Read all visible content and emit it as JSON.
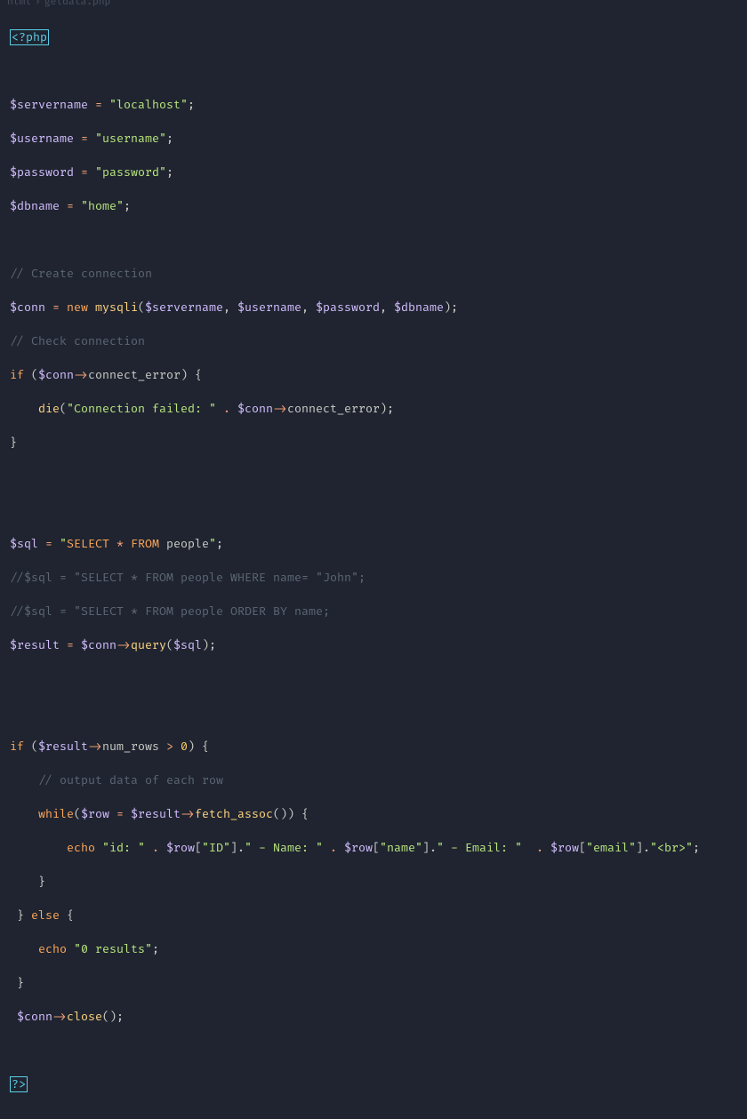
{
  "breadcrumb": {
    "seg1": "html",
    "seg2": "getdata.php"
  },
  "code": {
    "l1_open": "<?php",
    "l2_var": "$servername",
    "l2_eq": " = ",
    "l2_str": "\"localhost\"",
    "l2_sc": ";",
    "l3_var": "$username",
    "l3_eq": " = ",
    "l3_str": "\"username\"",
    "l3_sc": ";",
    "l4_var": "$password",
    "l4_eq": " = ",
    "l4_str": "\"password\"",
    "l4_sc": ";",
    "l5_var": "$dbname",
    "l5_eq": " = ",
    "l5_str": "\"home\"",
    "l5_sc": ";",
    "l6_comm": "// Create connection",
    "l7_var": "$conn",
    "l7_eq": " = ",
    "l7_new": "new",
    "l7_sp": " ",
    "l7_fn": "mysqli",
    "l7_op": "(",
    "l7_a1": "$servername",
    "l7_c1": ", ",
    "l7_a2": "$username",
    "l7_c2": ", ",
    "l7_a3": "$password",
    "l7_c3": ", ",
    "l7_a4": "$dbname",
    "l7_cp": ");",
    "l8_comm": "// Check connection",
    "l9_if": "if",
    "l9_sp": " (",
    "l9_var": "$conn",
    "l9_arr": "->",
    "l9_prop": "connect_error",
    "l9_cp": ") {",
    "l10_ind": "    ",
    "l10_fn": "die",
    "l10_op": "(",
    "l10_str": "\"Connection failed: \"",
    "l10_cat": " . ",
    "l10_var": "$conn",
    "l10_arr": "->",
    "l10_prop": "connect_error",
    "l10_cp": ");",
    "l11_cb": "}",
    "l12_var": "$sql",
    "l12_eq": " = ",
    "l12_q": "\"",
    "l12_sel": "SELECT",
    "l12_ast": " * ",
    "l12_from": "FROM",
    "l12_sp": " ",
    "l12_tbl": "people",
    "l12_q2": "\"",
    "l12_sc": ";",
    "l13_comm": "//$sql = \"SELECT * FROM people WHERE name= \"John\";",
    "l14_comm": "//$sql = \"SELECT * FROM people ORDER BY name;",
    "l15_var": "$result",
    "l15_eq": " = ",
    "l15_v2": "$conn",
    "l15_arr": "->",
    "l15_fn": "query",
    "l15_op": "(",
    "l15_arg": "$sql",
    "l15_cp": ");",
    "l16_if": "if",
    "l16_sp": " (",
    "l16_var": "$result",
    "l16_arr": "->",
    "l16_prop": "num_rows",
    "l16_gt": " > ",
    "l16_num": "0",
    "l16_cp": ") {",
    "l17_ind": "    ",
    "l17_comm": "// output data of each row",
    "l18_ind": "    ",
    "l18_while": "while",
    "l18_op": "(",
    "l18_var": "$row",
    "l18_eq": " = ",
    "l18_v2": "$result",
    "l18_arr": "->",
    "l18_fn": "fetch_assoc",
    "l18_pp": "()) {",
    "l19_ind": "        ",
    "l19_echo": "echo",
    "l19_sp": " ",
    "l19_s1": "\"id: \"",
    "l19_c1": " . ",
    "l19_r1": "$row",
    "l19_b1": "[",
    "l19_k1": "\"ID\"",
    "l19_bc1": "].",
    "l19_s2": "\" - Name: \"",
    "l19_c2": " . ",
    "l19_r2": "$row",
    "l19_b2": "[",
    "l19_k2": "\"name\"",
    "l19_bc2": "].",
    "l19_s3": "\" - Email: \"",
    "l19_c3": "  . ",
    "l19_r3": "$row",
    "l19_b3": "[",
    "l19_k3": "\"email\"",
    "l19_bc3": "].",
    "l19_s4": "\"<br>\"",
    "l19_sc": ";",
    "l20_ind": "    ",
    "l20_cb": "}",
    "l21_cb": "}",
    "l21_else": " else ",
    "l21_ob": "{",
    "l22_ind": "    ",
    "l22_echo": "echo",
    "l22_sp": " ",
    "l22_str": "\"0 results\"",
    "l22_sc": ";",
    "l23_cb": "}",
    "l24_var": "$conn",
    "l24_arr": "->",
    "l24_fn": "close",
    "l24_pp": "();",
    "l25_close": "?>"
  }
}
